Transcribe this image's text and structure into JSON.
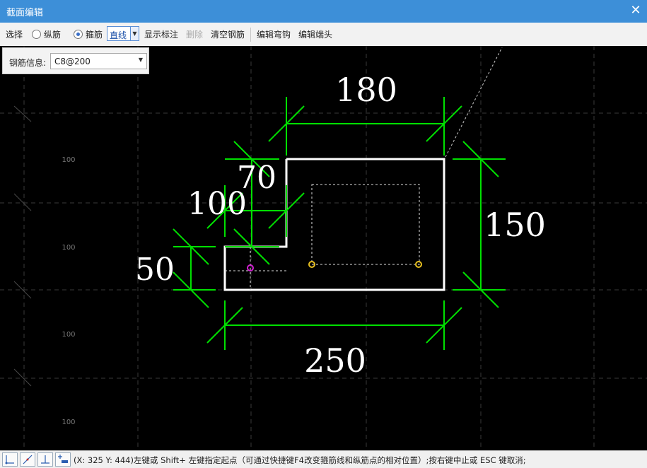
{
  "window": {
    "title": "截面编辑",
    "close_glyph": "✕"
  },
  "toolbar": {
    "select": "选择",
    "longitudinal": "纵筋",
    "stirrup": "箍筋",
    "line_mode": "直线",
    "show_annotations": "显示标注",
    "delete": "删除",
    "clear_rebar": "清空钢筋",
    "edit_hook": "编辑弯钩",
    "edit_end": "编辑端头"
  },
  "rebar_info": {
    "label": "钢筋信息:",
    "value": "C8@200"
  },
  "canvas": {
    "grid_labels": [
      "100",
      "100",
      "100",
      "100"
    ],
    "dimensions": {
      "top": "180",
      "right": "150",
      "bottom": "250",
      "left": "50",
      "step_height": "70",
      "step_width": "100"
    },
    "colors": {
      "background": "#000000",
      "dimension": "#00e000",
      "outline": "#ffffff",
      "rebar_point": "#e8c020",
      "active_point": "#d020d0"
    }
  },
  "status": {
    "coords": "(X: 325 Y: 444)",
    "message": "左键或 Shift+ 左键指定起点（可通过快捷键F4改变箍筋线和纵筋点的相对位置）;按右键中止或 ESC 键取消;"
  }
}
